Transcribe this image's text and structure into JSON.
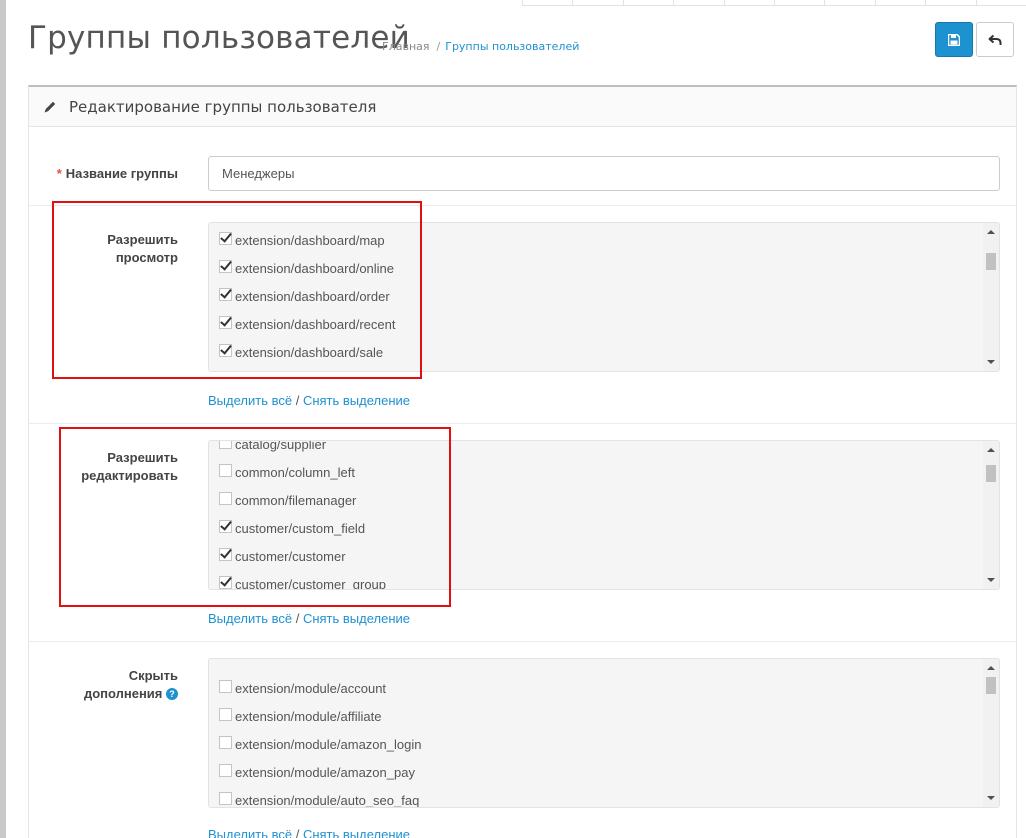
{
  "header": {
    "title": "Группы пользователей",
    "breadcrumb": [
      {
        "label": "Главная"
      },
      {
        "separator": "/",
        "label": "Группы пользователей"
      }
    ],
    "save_icon": "floppy-disk-icon",
    "back_icon": "reply-arrow-icon"
  },
  "panel": {
    "icon": "pencil-icon",
    "heading": "Редактирование группы пользователя"
  },
  "form": {
    "name": {
      "required_mark": "*",
      "label": "Название группы",
      "value": "Менеджеры"
    },
    "access": {
      "label_line1": "Разрешить",
      "label_line2": "просмотр",
      "items": [
        {
          "label": "extension/dashboard/map",
          "checked": true
        },
        {
          "label": "extension/dashboard/online",
          "checked": true
        },
        {
          "label": "extension/dashboard/order",
          "checked": true
        },
        {
          "label": "extension/dashboard/recent",
          "checked": true
        },
        {
          "label": "extension/dashboard/sale",
          "checked": true
        }
      ]
    },
    "modify": {
      "label_line1": "Разрешить",
      "label_line2": "редактировать",
      "items": [
        {
          "label": "catalog/supplier",
          "checked": false
        },
        {
          "label": "common/column_left",
          "checked": false
        },
        {
          "label": "common/filemanager",
          "checked": false
        },
        {
          "label": "customer/custom_field",
          "checked": true
        },
        {
          "label": "customer/customer",
          "checked": true
        },
        {
          "label": "customer/customer_group",
          "checked": true
        }
      ]
    },
    "hide": {
      "label_line1": "Скрыть",
      "label_line2": "дополнения",
      "help": "?",
      "items": [
        {
          "label": "extension/module/account",
          "checked": false
        },
        {
          "label": "extension/module/affiliate",
          "checked": false
        },
        {
          "label": "extension/module/amazon_login",
          "checked": false
        },
        {
          "label": "extension/module/amazon_pay",
          "checked": false
        },
        {
          "label": "extension/module/auto_seo_faq",
          "checked": false
        }
      ]
    },
    "select_all": "Выделить всё",
    "links_sep": "/",
    "unselect_all": "Снять выделение"
  },
  "colors": {
    "accent": "#1e91cf",
    "highlight_box": "#e01010",
    "required": "#e3503e"
  }
}
